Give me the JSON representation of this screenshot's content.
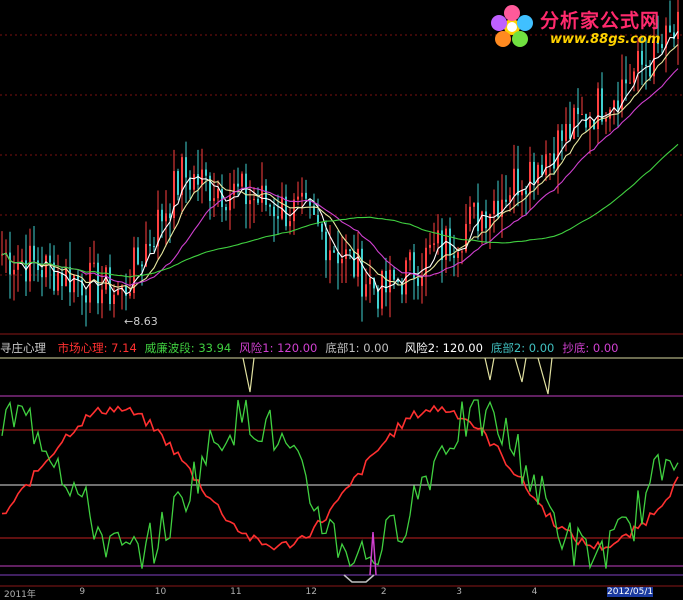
{
  "chart_data": [
    {
      "type": "candlestick",
      "series": [
        {
          "name": "",
          "color": "#ffffff"
        },
        {
          "name": "",
          "color": "#e8e8a0"
        },
        {
          "name": "",
          "color": "#d040d0"
        },
        {
          "name": "",
          "color": "#40d040"
        }
      ],
      "annotations": [
        {
          "text": "←8.63"
        }
      ],
      "grid": true
    },
    {
      "type": "line",
      "indicator_name": "寻庄心理",
      "legend": [
        {
          "label": "市场心理:",
          "value": "7.14",
          "color": "#ff3030"
        },
        {
          "label": "威廉波段:",
          "value": "33.94",
          "color": "#40d040"
        },
        {
          "label": "风险1:",
          "value": "120.00",
          "color": "#d040d0"
        },
        {
          "label": "底部1:",
          "value": "0.00",
          "color": "#c0c0c0"
        },
        {
          "label": "风险2:",
          "value": "120.00",
          "color": "#ffffff"
        },
        {
          "label": "底部2:",
          "value": "0.00",
          "color": "#40c0c0"
        },
        {
          "label": "抄底:",
          "value": "0.00",
          "color": "#d040d0"
        }
      ],
      "series": [
        {
          "name": "市场心理",
          "color": "#ff3030"
        },
        {
          "name": "威廉波段",
          "color": "#40d040"
        }
      ],
      "grid": true
    }
  ],
  "watermark": {
    "title": "分析家公式网",
    "url": "www.88gs.com"
  },
  "time_axis": [
    "2011年",
    "9",
    "10",
    "11",
    "12",
    "2",
    "3",
    "4",
    "2012/05/1"
  ]
}
